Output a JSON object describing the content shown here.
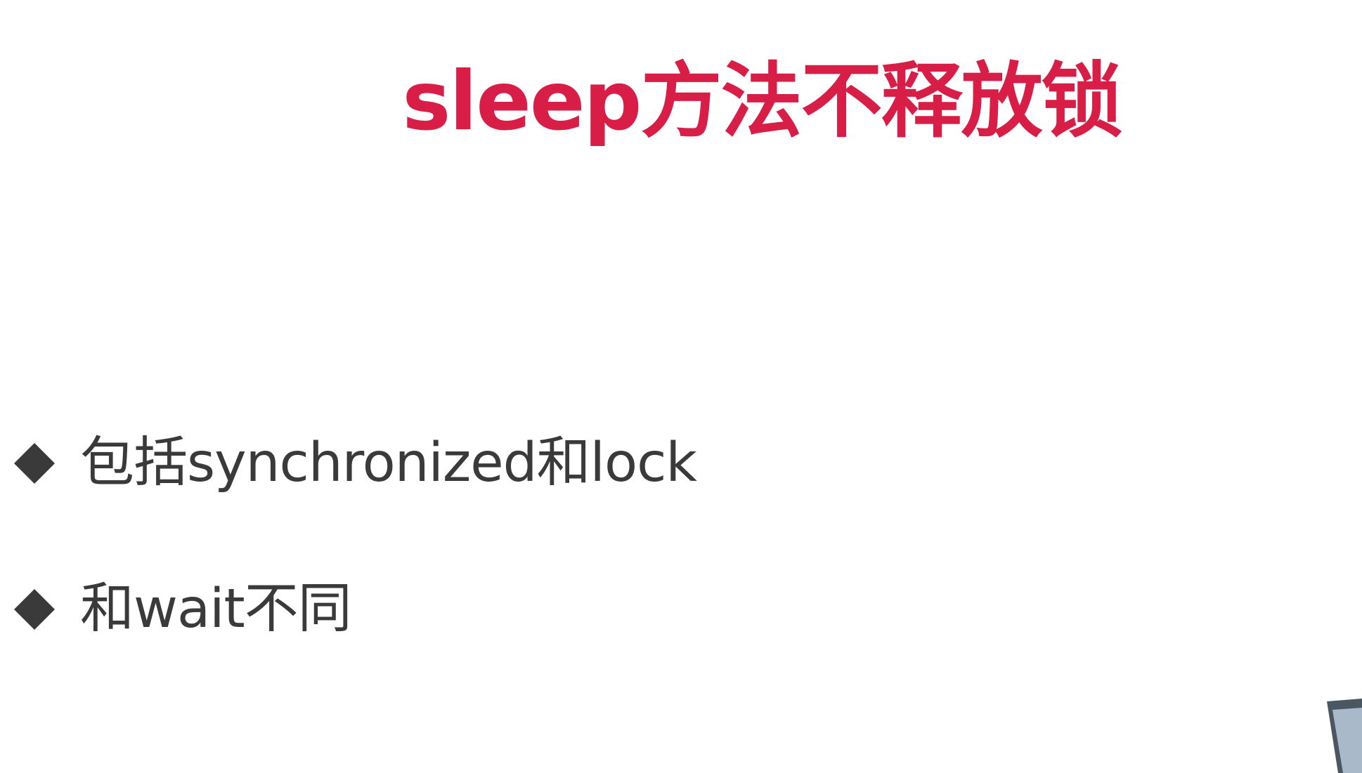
{
  "slide": {
    "title": "sleep方法不释放锁",
    "bullets": [
      {
        "text": "包括synchronized和lock",
        "icon": "diamond-bullet-icon"
      },
      {
        "text": "和wait不同",
        "icon": "diamond-bullet-icon"
      }
    ],
    "colors": {
      "title": "#d81e47",
      "text": "#3a3a3a",
      "bullet": "#3a3a3a",
      "background": "#ffffff",
      "decor_fill": "#a9b9c9",
      "decor_stroke": "#4b5663"
    }
  }
}
